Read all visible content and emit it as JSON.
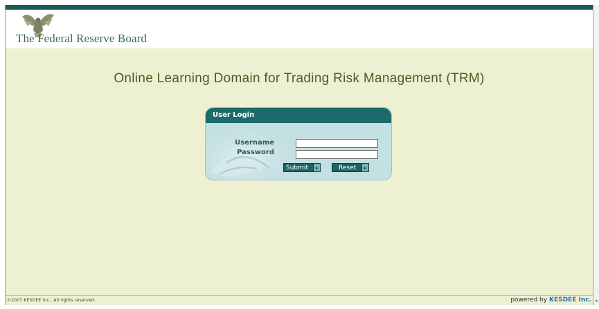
{
  "header": {
    "org_name": "The Federal Reserve Board"
  },
  "main": {
    "title": "Online Learning Domain for Trading Risk Management (TRM)"
  },
  "login": {
    "title": "User Login",
    "username_label": "Username",
    "password_label": "Password",
    "username_value": "",
    "password_value": "",
    "submit_label": "Submit",
    "reset_label": "Reset",
    "button_arrow": "▸"
  },
  "footer": {
    "copyright": "©2007 KESDEE Inc.. All rights reserved.",
    "powered_prefix": "powered by",
    "powered_brand": "KESDEE Inc."
  },
  "colors": {
    "page_background": "#eef0d2",
    "accent_teal": "#1c6b6b",
    "title_olive": "#4d5c25",
    "brand_blue": "#2a6fb5"
  },
  "icons": {
    "logo": "eagle-seal-icon",
    "login_art": "handshake-icon",
    "button_arrow": "arrow-right-icon"
  }
}
